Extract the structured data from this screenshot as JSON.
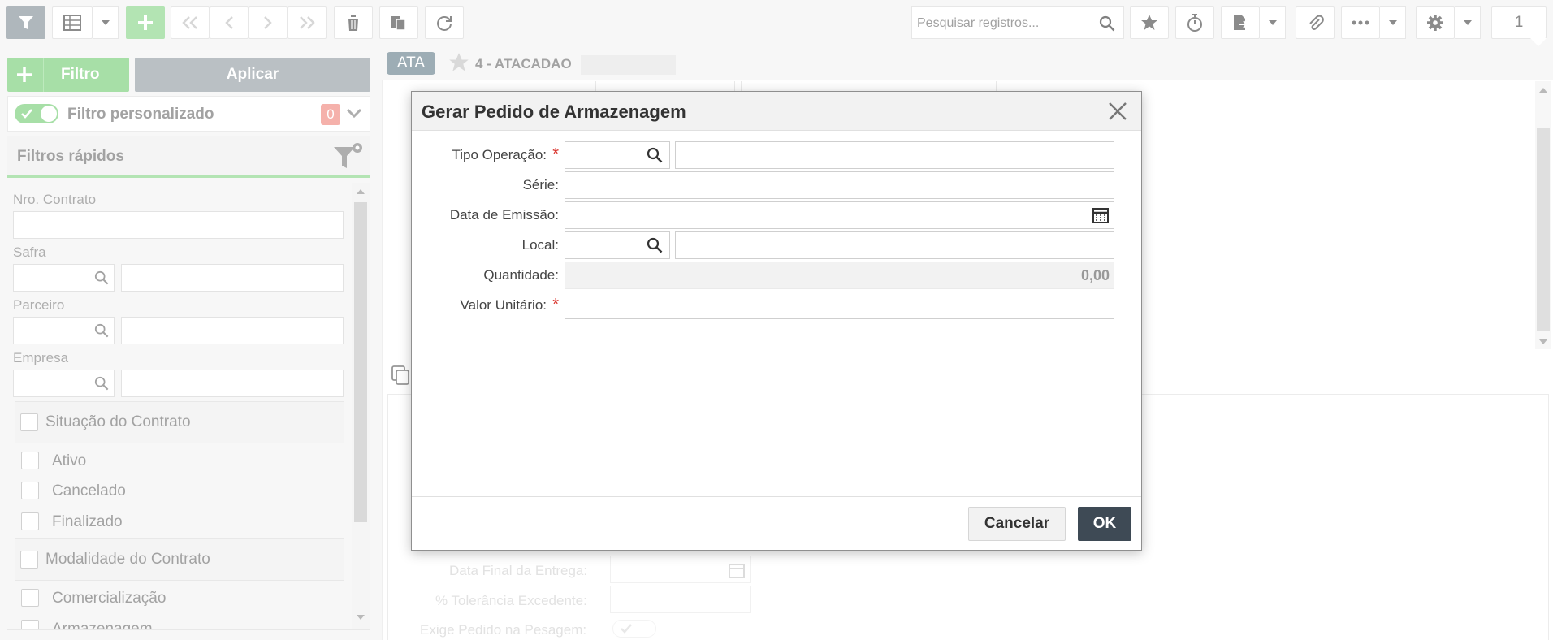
{
  "toolbar": {
    "search_placeholder": "Pesquisar registros...",
    "page_number": "1",
    "icons": [
      "filter-icon",
      "grid-view-icon",
      "add-icon",
      "first-icon",
      "previous-icon",
      "next-icon",
      "last-icon",
      "trash-icon",
      "copy-icon",
      "refresh-icon",
      "search-icon",
      "star-icon",
      "timer-icon",
      "export-icon",
      "attach-icon",
      "more-icon",
      "gear-icon"
    ]
  },
  "filter_panel": {
    "add_filter_label": "Filtro",
    "apply_label": "Aplicar",
    "custom_filter_label": "Filtro personalizado",
    "custom_filter_count": "0",
    "quick_filters_title": "Filtros rápidos",
    "fields": {
      "contract_no": "Nro. Contrato",
      "safra": "Safra",
      "parceiro": "Parceiro",
      "empresa": "Empresa"
    },
    "group_situacao": {
      "title": "Situação do Contrato",
      "options": [
        "Ativo",
        "Cancelado",
        "Finalizado"
      ]
    },
    "group_modalidade": {
      "title": "Modalidade do Contrato",
      "options": [
        "Comercialização",
        "Armazenagem"
      ]
    }
  },
  "record_header": {
    "company_badge": "ATA",
    "company_name": "4 - ATACADAO"
  },
  "background_form": {
    "data_final_entrega": "Data Final da Entrega:",
    "tolerancia": "% Tolerância Excedente:",
    "exige_pedido": "Exige Pedido na Pesagem:"
  },
  "modal": {
    "title": "Gerar Pedido de Armazenagem",
    "fields": {
      "tipo_operacao": "Tipo Operação:",
      "serie": "Série:",
      "data_emissao": "Data de Emissão:",
      "local": "Local:",
      "quantidade": "Quantidade:",
      "valor_unitario": "Valor Unitário:"
    },
    "required_mark": "*",
    "quantidade_value": "0,00",
    "cancel_label": "Cancelar",
    "ok_label": "OK"
  },
  "colors": {
    "accent_green": "#7ed07e",
    "apply_gray": "#9aa3a8",
    "badge_gray": "#6f8792",
    "ok_dark": "#3e4a55",
    "required_red": "#d9322b"
  }
}
